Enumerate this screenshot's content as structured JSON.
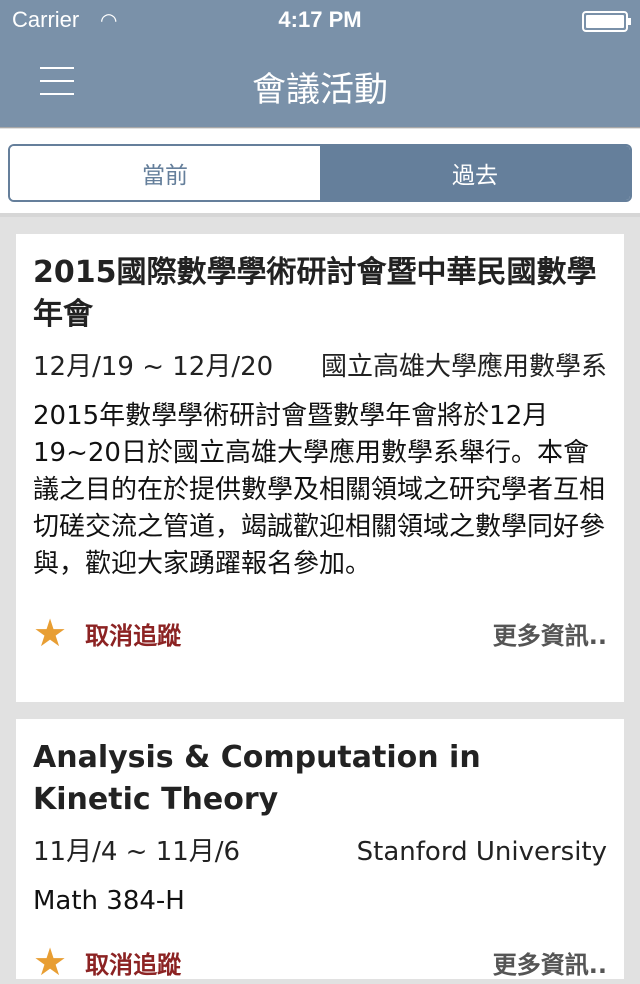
{
  "status": {
    "carrier": "Carrier",
    "time": "4:17 PM"
  },
  "nav": {
    "title": "會議活動"
  },
  "segments": [
    "當前",
    "過去"
  ],
  "events": [
    {
      "title": "2015國際數學學術研討會暨中華民國數學年會",
      "date": "12月/19 ~ 12月/20",
      "location": "國立高雄大學應用數學系",
      "description": "2015年數學學術研討會暨數學年會將於12月19~20日於國立高雄大學應用數學系舉行。本會議之目的在於提供數學及相關領域之研究學者互相切磋交流之管道，竭誠歡迎相關領域之數學同好參與，歡迎大家踴躍報名參加。",
      "unfollow": "取消追蹤",
      "more": "更多資訊.."
    },
    {
      "title": "Analysis & Computation in Kinetic Theory",
      "date": "11月/4 ~ 11月/6",
      "location": "Stanford University",
      "description": "Math 384-H",
      "unfollow": "取消追蹤",
      "more": "更多資訊.."
    }
  ]
}
